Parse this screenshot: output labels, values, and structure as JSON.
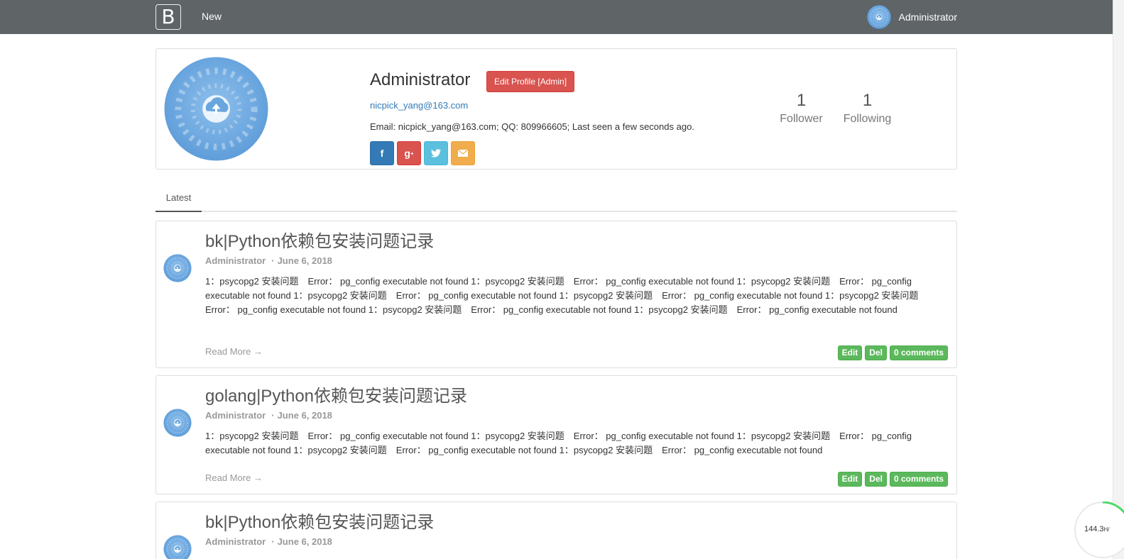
{
  "navbar": {
    "brand": "B",
    "new_label": "New",
    "user_name": "Administrator"
  },
  "profile": {
    "name": "Administrator",
    "edit_button": "Edit Profile [Admin]",
    "email_link": "nicpick_yang@163.com",
    "info": "Email: nicpick_yang@163.com; QQ: 809966605; Last seen a few seconds ago.",
    "social_icons": [
      "facebook-icon",
      "google-plus-icon",
      "twitter-icon",
      "envelope-icon"
    ],
    "followers_count": "1",
    "followers_label": "Follower",
    "following_count": "1",
    "following_label": "Following"
  },
  "tabs": {
    "latest": "Latest"
  },
  "posts": [
    {
      "title": "bk|Python依赖包安装问题记录",
      "author": "Administrator",
      "date": "June 6, 2018",
      "body": "1：psycopg2 安装问题　Error： pg_config executable not found 1：psycopg2 安装问题　Error： pg_config executable not found 1：psycopg2 安装问题　Error： pg_config executable not found 1：psycopg2 安装问题　Error： pg_config executable not found 1：psycopg2 安装问题　Error： pg_config executable not found 1：psycopg2 安装问题　Error： pg_config executable not found 1：psycopg2 安装问题　Error： pg_config executable not found 1：psycopg2 安装问题　Error： pg_config executable not found",
      "read_more": "Read More →",
      "edit": "Edit",
      "del": "Del",
      "comments": "0 comments"
    },
    {
      "title": "golang|Python依赖包安装问题记录",
      "author": "Administrator",
      "date": "June 6, 2018",
      "body": "1：psycopg2 安装问题　Error： pg_config executable not found 1：psycopg2 安装问题　Error： pg_config executable not found 1：psycopg2 安装问题　Error： pg_config executable not found 1：psycopg2 安装问题　Error： pg_config executable not found 1：psycopg2 安装问题　Error： pg_config executable not found",
      "read_more": "Read More →",
      "edit": "Edit",
      "del": "Del",
      "comments": "0 comments"
    },
    {
      "title": "bk|Python依赖包安装问题记录",
      "author": "Administrator",
      "date": "June 6, 2018"
    }
  ],
  "speed_widget": {
    "value": "144.3",
    "unit": "H/"
  },
  "colors": {
    "navbar": "#5f6467",
    "danger": "#d9534f",
    "primary": "#337ab7",
    "info": "#5bc0de",
    "warning": "#f0ad4e",
    "success": "#5cb85c"
  }
}
